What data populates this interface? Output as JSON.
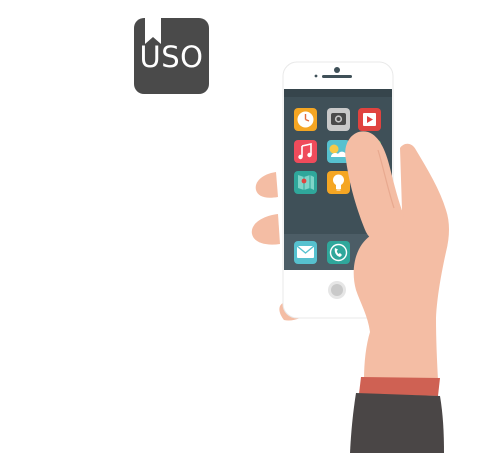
{
  "badge": {
    "text": "USO",
    "icon": "bookmark-icon",
    "background": "#4a4a4a"
  },
  "phone": {
    "screen_color": "#3f5058",
    "body_color": "#ffffff",
    "app_icons": [
      "clock-icon",
      "camera-icon",
      "video-play-icon",
      "music-icon",
      "weather-icon",
      "messages-icon",
      "maps-icon",
      "lightbulb-icon"
    ],
    "dock_icons": [
      "mail-icon",
      "phone-icon"
    ]
  },
  "colors": {
    "skin": "#f4bda4",
    "sleeve": "#4a4646",
    "cuff": "#cf6153"
  }
}
